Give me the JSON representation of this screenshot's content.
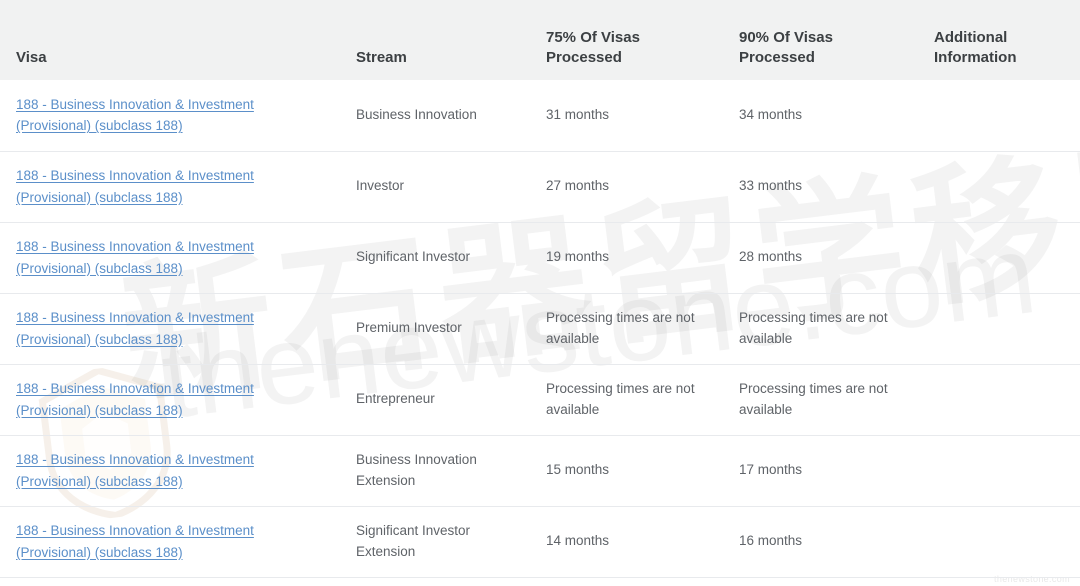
{
  "table": {
    "headers": [
      {
        "label": "Visa",
        "key": "visa"
      },
      {
        "label": "Stream",
        "key": "stream"
      },
      {
        "label": "75% Of Visas Processed",
        "key": "p75"
      },
      {
        "label": "90% Of Visas Processed",
        "key": "p90"
      },
      {
        "label": "Additional Information",
        "key": "extra"
      }
    ],
    "rows": [
      {
        "visa": "188 - Business Innovation & Investment (Provisional) (subclass 188)",
        "stream": "Business Innovation",
        "p75": "31 months",
        "p90": "34 months",
        "extra": ""
      },
      {
        "visa": "188 - Business Innovation & Investment (Provisional) (subclass 188)",
        "stream": "Investor",
        "p75": "27 months",
        "p90": "33 months",
        "extra": ""
      },
      {
        "visa": "188 - Business Innovation & Investment (Provisional) (subclass 188)",
        "stream": "Significant Investor",
        "p75": "19 months",
        "p90": "28 months",
        "extra": ""
      },
      {
        "visa": "188 - Business Innovation & Investment (Provisional) (subclass 188)",
        "stream": "Premium Investor",
        "p75": "Processing times are not available",
        "p90": "Processing times are not available",
        "extra": ""
      },
      {
        "visa": "188 - Business Innovation & Investment (Provisional) (subclass 188)",
        "stream": "Entrepreneur",
        "p75": "Processing times are not available",
        "p90": "Processing times are not available",
        "extra": ""
      },
      {
        "visa": "188 - Business Innovation & Investment (Provisional) (subclass 188)",
        "stream": "Business Innovation Extension",
        "p75": "15 months",
        "p90": "17 months",
        "extra": ""
      },
      {
        "visa": "188 - Business Innovation & Investment (Provisional) (subclass 188)",
        "stream": "Significant Investor Extension",
        "p75": "14 months",
        "p90": "16 months",
        "extra": ""
      }
    ]
  },
  "watermark": {
    "chinese_text": "新石器留学移民",
    "domain_text": "thenewstone.com",
    "corner_text": "thenewstone.com"
  },
  "colors": {
    "header_background": "#f1f2f2",
    "header_text": "#3c4043",
    "body_text": "#5f6368",
    "link": "#5b8fc9",
    "row_divider": "#e8eaed",
    "page_background": "#ffffff"
  }
}
